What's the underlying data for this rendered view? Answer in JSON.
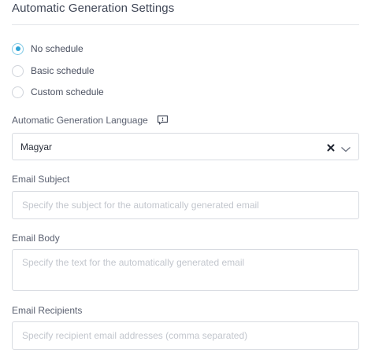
{
  "section": {
    "title": "Automatic Generation Settings"
  },
  "schedule": {
    "options": [
      {
        "label": "No schedule",
        "checked": true
      },
      {
        "label": "Basic schedule",
        "checked": false
      },
      {
        "label": "Custom schedule",
        "checked": false
      }
    ]
  },
  "language": {
    "label": "Automatic Generation Language",
    "value": "Magyar",
    "tooltip_icon": "comment-icon",
    "clear_icon": "close-icon",
    "dropdown_icon": "chevron-down-icon"
  },
  "email_subject": {
    "label": "Email Subject",
    "value": "",
    "placeholder": "Specify the subject for the automatically generated email"
  },
  "email_body": {
    "label": "Email Body",
    "value": "",
    "placeholder": "Specify the text for the automatically generated email"
  },
  "email_recipients": {
    "label": "Email Recipients",
    "value": "",
    "placeholder": "Specify recipient email addresses (comma separated)"
  },
  "colors": {
    "accent": "#2fa4d6",
    "border": "#d8dbe1",
    "placeholder": "#c2c6cd"
  }
}
